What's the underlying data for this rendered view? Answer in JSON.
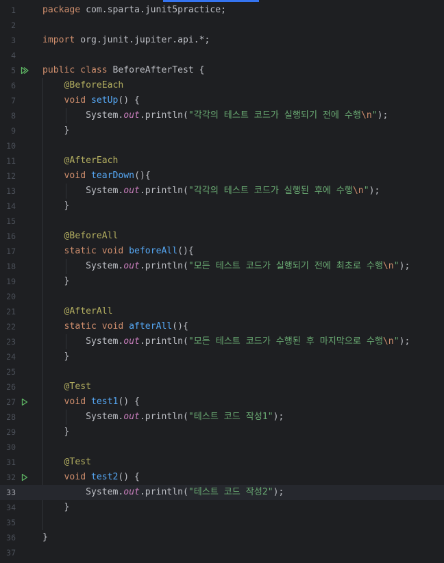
{
  "editor": {
    "current_line": 33,
    "lines": [
      {
        "n": "1",
        "tokens": [
          {
            "t": "kw",
            "v": "package"
          },
          {
            "t": "plain",
            "v": " com.sparta.junit5practice;"
          }
        ]
      },
      {
        "n": "2",
        "tokens": []
      },
      {
        "n": "3",
        "tokens": [
          {
            "t": "kw",
            "v": "import"
          },
          {
            "t": "plain",
            "v": " org.junit.jupiter.api.*;"
          }
        ]
      },
      {
        "n": "4",
        "tokens": []
      },
      {
        "n": "5",
        "run": "run-all-icon",
        "tokens": [
          {
            "t": "kw",
            "v": "public class"
          },
          {
            "t": "plain",
            "v": " BeforeAfterTest {"
          }
        ]
      },
      {
        "n": "6",
        "tokens": [
          {
            "t": "plain",
            "v": "    "
          },
          {
            "t": "ann",
            "v": "@BeforeEach"
          }
        ]
      },
      {
        "n": "7",
        "tokens": [
          {
            "t": "plain",
            "v": "    "
          },
          {
            "t": "kw",
            "v": "void"
          },
          {
            "t": "plain",
            "v": " "
          },
          {
            "t": "fn",
            "v": "setUp"
          },
          {
            "t": "plain",
            "v": "() {"
          }
        ]
      },
      {
        "n": "8",
        "tokens": [
          {
            "t": "plain",
            "v": "        System."
          },
          {
            "t": "st",
            "v": "out"
          },
          {
            "t": "plain",
            "v": ".println("
          },
          {
            "t": "str",
            "v": "\"각각의 테스트 코드가 실행되기 전에 수행"
          },
          {
            "t": "esc",
            "v": "\\n"
          },
          {
            "t": "str",
            "v": "\""
          },
          {
            "t": "plain",
            "v": ");"
          }
        ]
      },
      {
        "n": "9",
        "tokens": [
          {
            "t": "plain",
            "v": "    }"
          }
        ]
      },
      {
        "n": "10",
        "tokens": []
      },
      {
        "n": "11",
        "tokens": [
          {
            "t": "plain",
            "v": "    "
          },
          {
            "t": "ann",
            "v": "@AfterEach"
          }
        ]
      },
      {
        "n": "12",
        "tokens": [
          {
            "t": "plain",
            "v": "    "
          },
          {
            "t": "kw",
            "v": "void"
          },
          {
            "t": "plain",
            "v": " "
          },
          {
            "t": "fn",
            "v": "tearDown"
          },
          {
            "t": "plain",
            "v": "(){"
          }
        ]
      },
      {
        "n": "13",
        "tokens": [
          {
            "t": "plain",
            "v": "        System."
          },
          {
            "t": "st",
            "v": "out"
          },
          {
            "t": "plain",
            "v": ".println("
          },
          {
            "t": "str",
            "v": "\"각각의 테스트 코드가 실행된 후에 수행"
          },
          {
            "t": "esc",
            "v": "\\n"
          },
          {
            "t": "str",
            "v": "\""
          },
          {
            "t": "plain",
            "v": ");"
          }
        ]
      },
      {
        "n": "14",
        "tokens": [
          {
            "t": "plain",
            "v": "    }"
          }
        ]
      },
      {
        "n": "15",
        "tokens": []
      },
      {
        "n": "16",
        "tokens": [
          {
            "t": "plain",
            "v": "    "
          },
          {
            "t": "ann",
            "v": "@BeforeAll"
          }
        ]
      },
      {
        "n": "17",
        "tokens": [
          {
            "t": "plain",
            "v": "    "
          },
          {
            "t": "kw",
            "v": "static void"
          },
          {
            "t": "plain",
            "v": " "
          },
          {
            "t": "fn",
            "v": "beforeAll"
          },
          {
            "t": "plain",
            "v": "(){"
          }
        ]
      },
      {
        "n": "18",
        "tokens": [
          {
            "t": "plain",
            "v": "        System."
          },
          {
            "t": "st",
            "v": "out"
          },
          {
            "t": "plain",
            "v": ".println("
          },
          {
            "t": "str",
            "v": "\"모든 테스트 코드가 실행되기 전에 최초로 수행"
          },
          {
            "t": "esc",
            "v": "\\n"
          },
          {
            "t": "str",
            "v": "\""
          },
          {
            "t": "plain",
            "v": ");"
          }
        ]
      },
      {
        "n": "19",
        "tokens": [
          {
            "t": "plain",
            "v": "    }"
          }
        ]
      },
      {
        "n": "20",
        "tokens": []
      },
      {
        "n": "21",
        "tokens": [
          {
            "t": "plain",
            "v": "    "
          },
          {
            "t": "ann",
            "v": "@AfterAll"
          }
        ]
      },
      {
        "n": "22",
        "tokens": [
          {
            "t": "plain",
            "v": "    "
          },
          {
            "t": "kw",
            "v": "static void"
          },
          {
            "t": "plain",
            "v": " "
          },
          {
            "t": "fn",
            "v": "afterAll"
          },
          {
            "t": "plain",
            "v": "(){"
          }
        ]
      },
      {
        "n": "23",
        "tokens": [
          {
            "t": "plain",
            "v": "        System."
          },
          {
            "t": "st",
            "v": "out"
          },
          {
            "t": "plain",
            "v": ".println("
          },
          {
            "t": "str",
            "v": "\"모든 테스트 코드가 수행된 후 마지막으로 수행"
          },
          {
            "t": "esc",
            "v": "\\n"
          },
          {
            "t": "str",
            "v": "\""
          },
          {
            "t": "plain",
            "v": ");"
          }
        ]
      },
      {
        "n": "24",
        "tokens": [
          {
            "t": "plain",
            "v": "    }"
          }
        ]
      },
      {
        "n": "25",
        "tokens": []
      },
      {
        "n": "26",
        "tokens": [
          {
            "t": "plain",
            "v": "    "
          },
          {
            "t": "ann",
            "v": "@Test"
          }
        ]
      },
      {
        "n": "27",
        "run": "run-test-icon",
        "tokens": [
          {
            "t": "plain",
            "v": "    "
          },
          {
            "t": "kw",
            "v": "void"
          },
          {
            "t": "plain",
            "v": " "
          },
          {
            "t": "fn",
            "v": "test1"
          },
          {
            "t": "plain",
            "v": "() {"
          }
        ]
      },
      {
        "n": "28",
        "tokens": [
          {
            "t": "plain",
            "v": "        System."
          },
          {
            "t": "st",
            "v": "out"
          },
          {
            "t": "plain",
            "v": ".println("
          },
          {
            "t": "str",
            "v": "\"테스트 코드 작성1\""
          },
          {
            "t": "plain",
            "v": ");"
          }
        ]
      },
      {
        "n": "29",
        "tokens": [
          {
            "t": "plain",
            "v": "    }"
          }
        ]
      },
      {
        "n": "30",
        "tokens": []
      },
      {
        "n": "31",
        "tokens": [
          {
            "t": "plain",
            "v": "    "
          },
          {
            "t": "ann",
            "v": "@Test"
          }
        ]
      },
      {
        "n": "32",
        "run": "run-test-icon",
        "tokens": [
          {
            "t": "plain",
            "v": "    "
          },
          {
            "t": "kw",
            "v": "void"
          },
          {
            "t": "plain",
            "v": " "
          },
          {
            "t": "fn",
            "v": "test2"
          },
          {
            "t": "plain",
            "v": "() {"
          }
        ]
      },
      {
        "n": "33",
        "tokens": [
          {
            "t": "plain",
            "v": "        System."
          },
          {
            "t": "st",
            "v": "out"
          },
          {
            "t": "plain",
            "v": ".println("
          },
          {
            "t": "str",
            "v": "\"테스트 코드 작성2\""
          },
          {
            "t": "plain",
            "v": ");"
          }
        ]
      },
      {
        "n": "34",
        "tokens": [
          {
            "t": "plain",
            "v": "    }"
          }
        ]
      },
      {
        "n": "35",
        "tokens": []
      },
      {
        "n": "36",
        "tokens": [
          {
            "t": "plain",
            "v": "}"
          }
        ]
      },
      {
        "n": "37",
        "tokens": []
      }
    ]
  },
  "colors": {
    "background": "#1e1f22",
    "current_line": "#26282e",
    "keyword": "#cf8e6d",
    "annotation": "#b3ae60",
    "method": "#56a8f5",
    "static_field": "#c77dbb",
    "string": "#6aab73",
    "run_icon": "#5fb865",
    "tab_accent": "#3574f0"
  }
}
